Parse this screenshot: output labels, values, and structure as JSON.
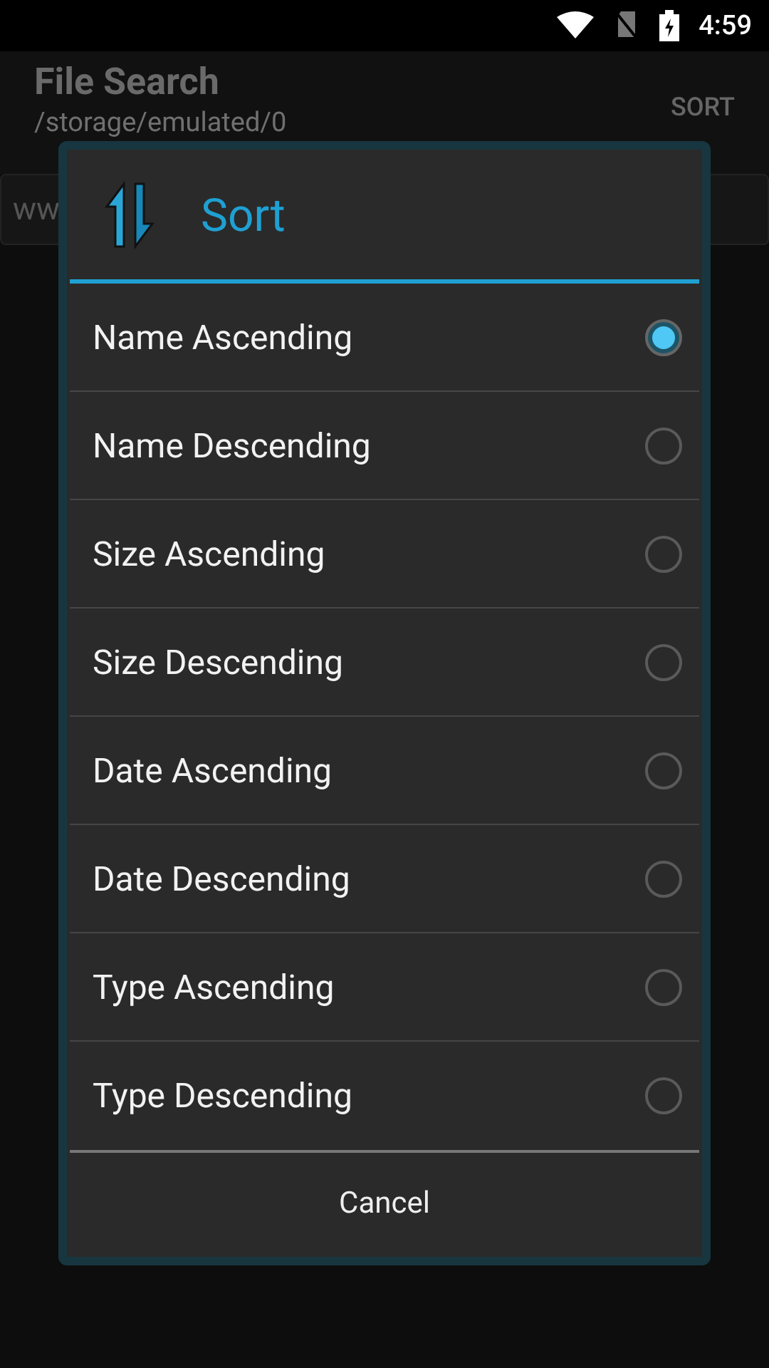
{
  "status_bar": {
    "time": "4:59"
  },
  "app_bar": {
    "title": "File Search",
    "subtitle": "/storage/emulated/0",
    "action": "SORT"
  },
  "search": {
    "value": "ww"
  },
  "dialog": {
    "title": "Sort",
    "options": [
      {
        "label": "Name Ascending",
        "selected": true
      },
      {
        "label": "Name Descending",
        "selected": false
      },
      {
        "label": "Size Ascending",
        "selected": false
      },
      {
        "label": "Size Descending",
        "selected": false
      },
      {
        "label": "Date Ascending",
        "selected": false
      },
      {
        "label": "Date Descending",
        "selected": false
      },
      {
        "label": "Type Ascending",
        "selected": false
      },
      {
        "label": "Type Descending",
        "selected": false
      }
    ],
    "button": "Cancel"
  }
}
